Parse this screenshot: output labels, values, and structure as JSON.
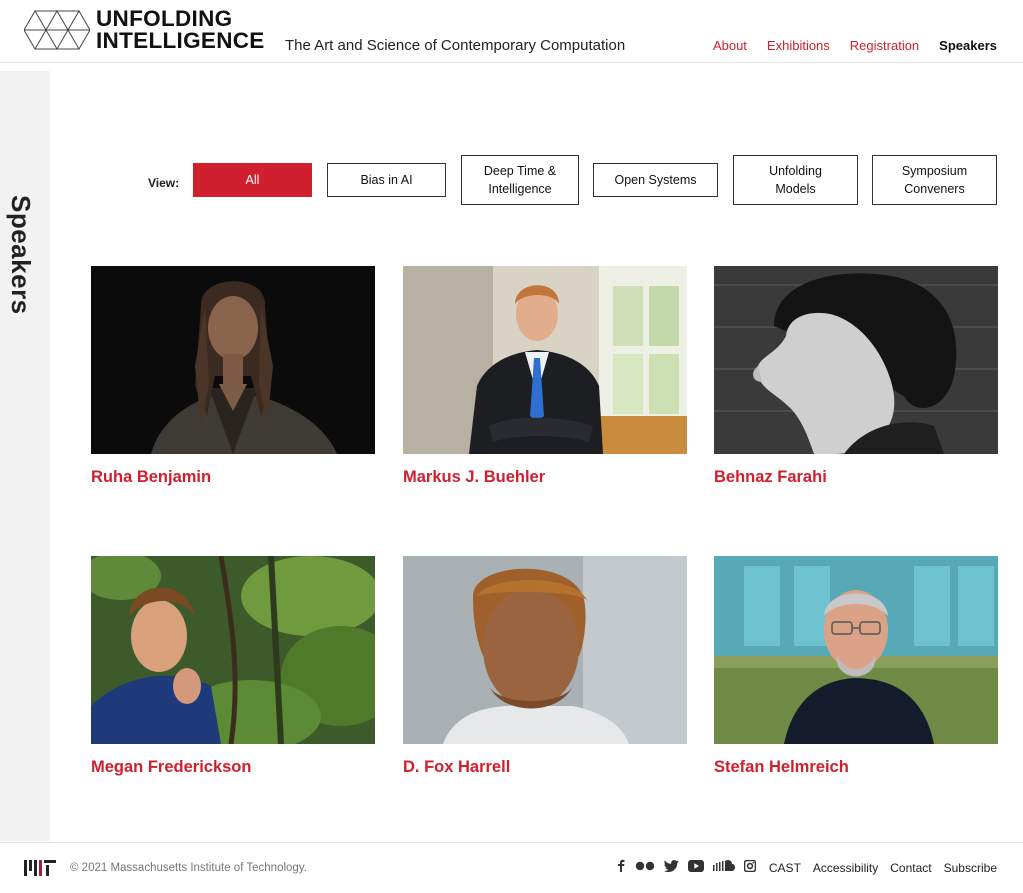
{
  "header": {
    "logo_line1": "UNFOLDING",
    "logo_line2": "INTELLIGENCE",
    "tagline": "The Art and Science of Contemporary Computation",
    "nav": [
      {
        "label": "About",
        "active": false
      },
      {
        "label": "Exhibitions",
        "active": false
      },
      {
        "label": "Registration",
        "active": false
      },
      {
        "label": "Speakers",
        "active": true
      }
    ]
  },
  "sidebar": {
    "title": "Speakers"
  },
  "filters": {
    "label": "View:",
    "options": [
      {
        "label": "All",
        "active": true
      },
      {
        "label": "Bias in AI",
        "active": false
      },
      {
        "label": "Deep Time &\nIntelligence",
        "active": false
      },
      {
        "label": "Open Systems",
        "active": false
      },
      {
        "label": "Unfolding\nModels",
        "active": false
      },
      {
        "label": "Symposium\nConveners",
        "active": false
      }
    ]
  },
  "speakers": [
    {
      "name": "Ruha Benjamin"
    },
    {
      "name": "Markus J. Buehler"
    },
    {
      "name": "Behnaz Farahi"
    },
    {
      "name": "Megan Frederickson"
    },
    {
      "name": "D. Fox Harrell"
    },
    {
      "name": "Stefan Helmreich"
    }
  ],
  "footer": {
    "copyright": "© 2021 Massachusetts Institute of Technology.",
    "social_icons": [
      "facebook-icon",
      "flickr-icon",
      "twitter-icon",
      "youtube-icon",
      "soundcloud-icon",
      "instagram-icon"
    ],
    "links": [
      "CAST",
      "Accessibility",
      "Contact",
      "Subscribe"
    ]
  },
  "colors": {
    "accent": "#d0202e",
    "text": "#111111",
    "rail": "#f2f2f2"
  }
}
